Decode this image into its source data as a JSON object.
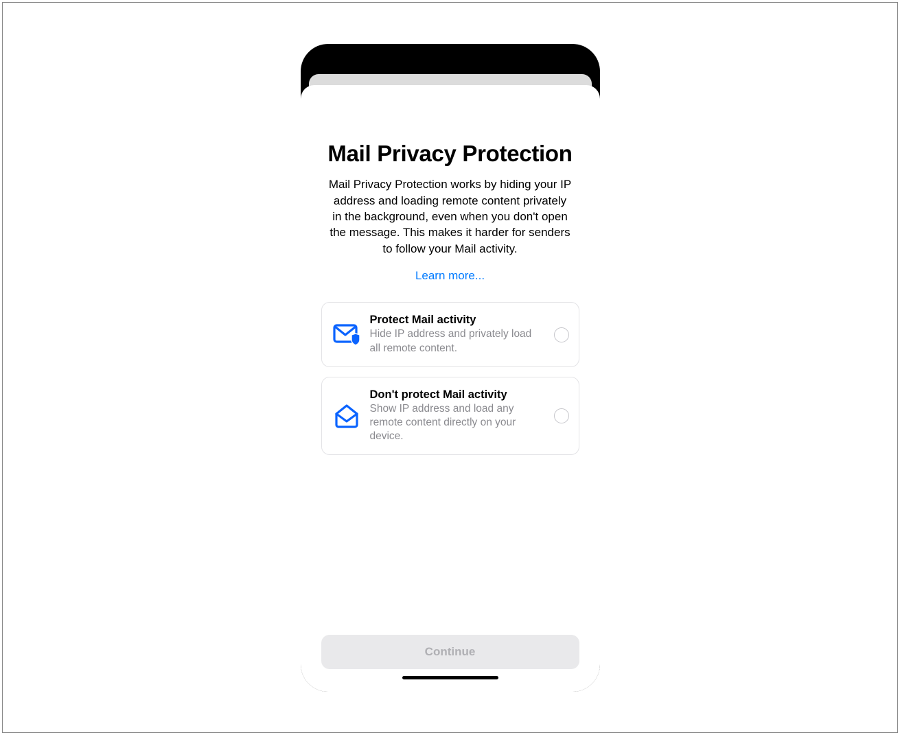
{
  "title": "Mail Privacy Protection",
  "description": "Mail Privacy Protection works by hiding your IP address and loading remote content privately in the background, even when you don't open the message. This makes it harder for senders to follow your Mail activity.",
  "learn_more": "Learn more...",
  "options": {
    "protect": {
      "title": "Protect Mail activity",
      "subtitle": "Hide IP address and privately load all remote content."
    },
    "dont_protect": {
      "title": "Don't protect Mail activity",
      "subtitle": "Show IP address and load any remote content directly on your device."
    }
  },
  "continue_label": "Continue",
  "colors": {
    "accent": "#007aff",
    "muted_text": "#8a8a8f",
    "disabled_bg": "#e9e9eb",
    "disabled_text": "#b0b0b4"
  }
}
